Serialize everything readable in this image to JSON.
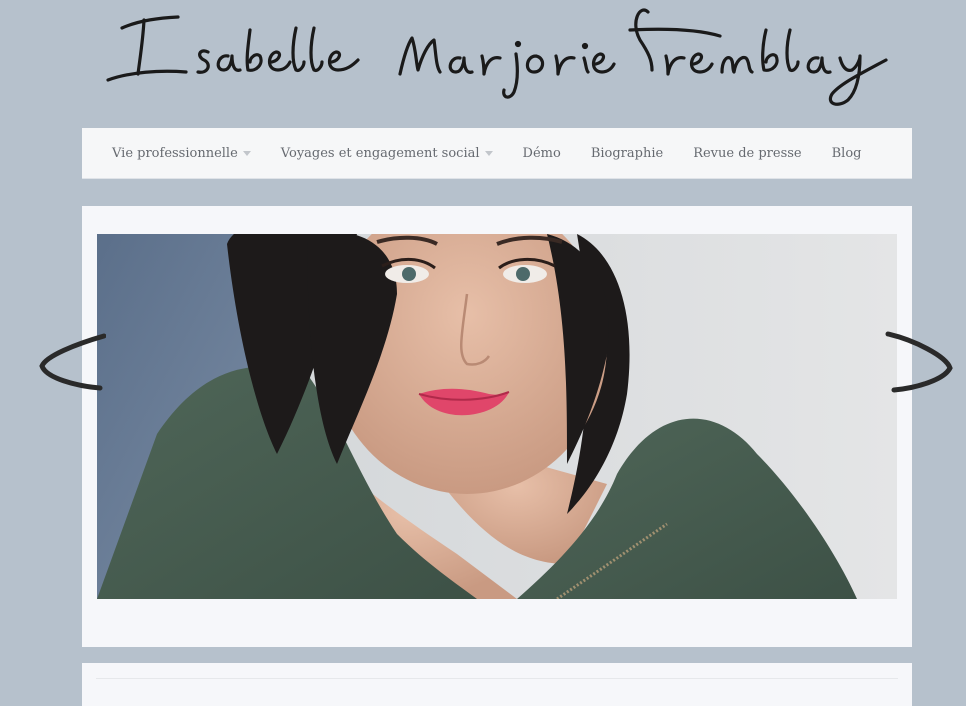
{
  "site": {
    "signature": "Isabelle Marjorie Tremblay"
  },
  "nav": {
    "items": [
      {
        "label": "Vie professionnelle",
        "has_submenu": true
      },
      {
        "label": "Voyages et engagement social",
        "has_submenu": true
      },
      {
        "label": "Démo",
        "has_submenu": false
      },
      {
        "label": "Biographie",
        "has_submenu": false
      },
      {
        "label": "Revue de presse",
        "has_submenu": false
      },
      {
        "label": "Blog",
        "has_submenu": false
      }
    ]
  },
  "slider": {
    "image": "portrait-photo",
    "prev_icon": "chevron-left-icon",
    "next_icon": "chevron-right-icon"
  },
  "colors": {
    "page_bg": "#b6c1cc",
    "panel_bg": "#f6f7fa",
    "nav_text": "#666a70"
  }
}
